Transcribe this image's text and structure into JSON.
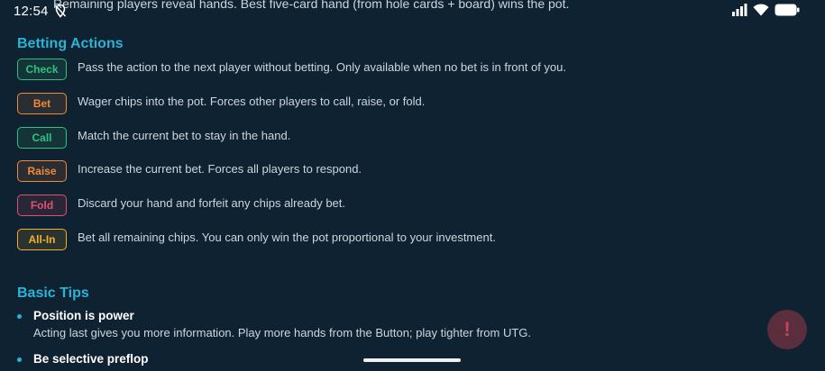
{
  "status_bar": {
    "time": "12:54"
  },
  "top_cut_text": "Remaining players reveal hands. Best five-card hand (from hole cards + board) wins the pot.",
  "betting": {
    "title": "Betting Actions",
    "actions": [
      {
        "label": "Check",
        "desc": "Pass the action to the next player without betting. Only available when no bet is in front of you.",
        "color": "#2ec27e"
      },
      {
        "label": "Bet",
        "desc": "Wager chips into the pot. Forces other players to call, raise, or fold.",
        "color": "#f08a3a"
      },
      {
        "label": "Call",
        "desc": "Match the current bet to stay in the hand.",
        "color": "#2ec27e"
      },
      {
        "label": "Raise",
        "desc": "Increase the current bet. Forces all players to respond.",
        "color": "#f08a3a"
      },
      {
        "label": "Fold",
        "desc": "Discard your hand and forfeit any chips already bet.",
        "color": "#e2506f"
      },
      {
        "label": "All-In",
        "desc": "Bet all remaining chips. You can only win the pot proportional to your investment.",
        "color": "#f2b226"
      }
    ]
  },
  "tips": {
    "title": "Basic Tips",
    "items": [
      {
        "title": "Position is power",
        "body": "Acting last gives you more information. Play more hands from the Button; play tighter from UTG."
      },
      {
        "title": "Be selective preflop",
        "body": ""
      }
    ]
  },
  "fab": {
    "label": "!"
  },
  "colors": {
    "background": "#0f2231",
    "accent": "#2bb3d6",
    "fab_bg": "#5a2e3c"
  }
}
